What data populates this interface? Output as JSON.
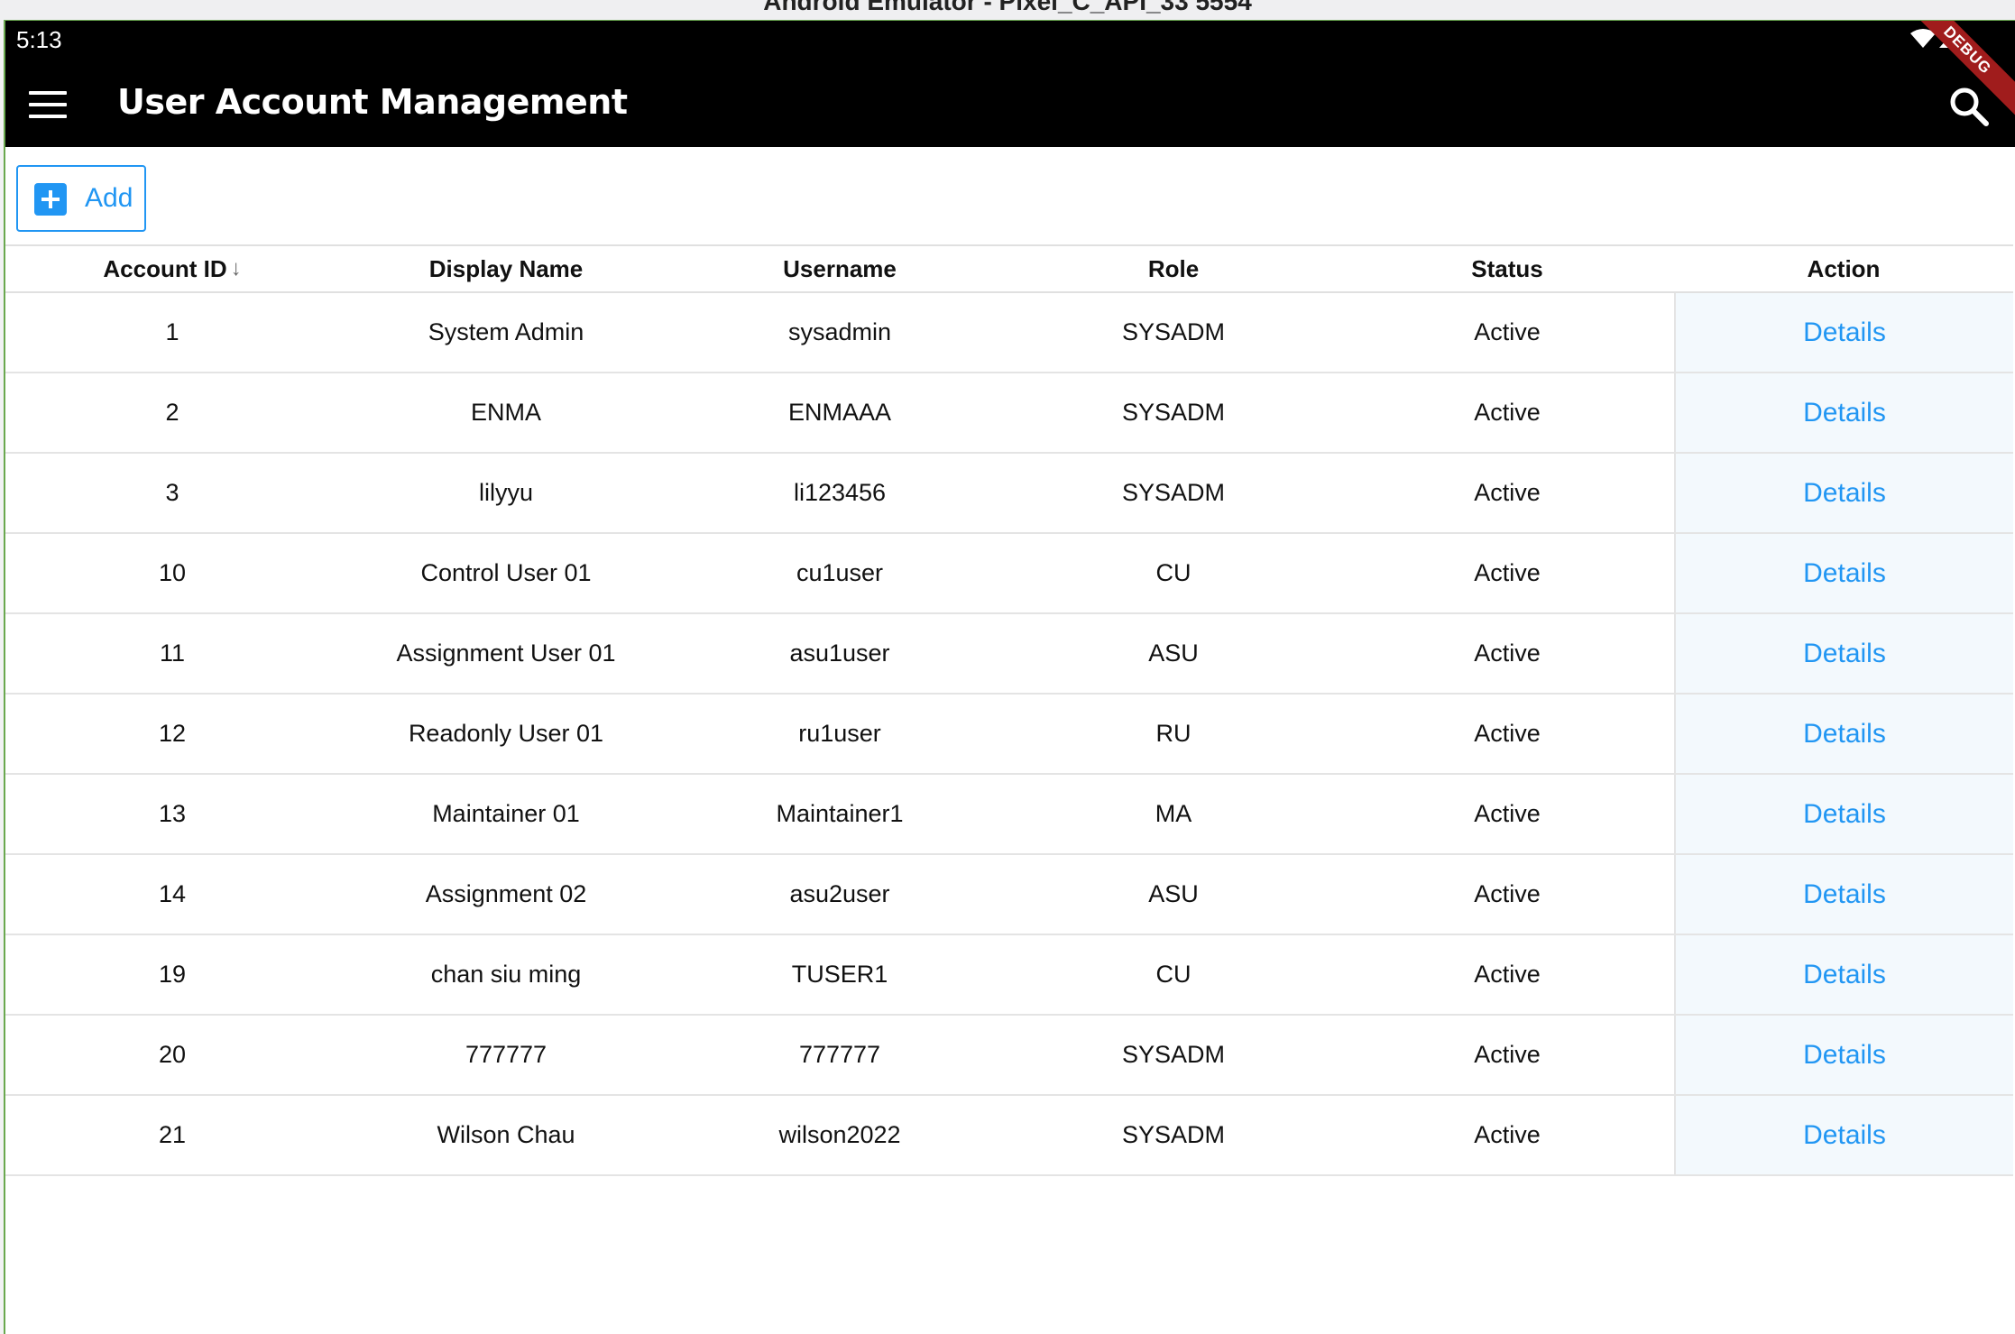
{
  "window_title": "Android Emulator - Pixel_C_API_33 5554",
  "status_bar": {
    "time": "5:13"
  },
  "app_bar": {
    "title": "User Account Management",
    "debug_banner": "DEBUG"
  },
  "toolbar": {
    "add_label": "Add"
  },
  "table": {
    "columns": [
      "Account ID",
      "Display Name",
      "Username",
      "Role",
      "Status",
      "Action"
    ],
    "sort_column": "Account ID",
    "rows": [
      {
        "id": "1",
        "display_name": "System Admin",
        "username": "sysadmin",
        "role": "SYSADM",
        "status": "Active",
        "action": "Details"
      },
      {
        "id": "2",
        "display_name": "ENMA",
        "username": "ENMAAA",
        "role": "SYSADM",
        "status": "Active",
        "action": "Details"
      },
      {
        "id": "3",
        "display_name": "lilyyu",
        "username": "li123456",
        "role": "SYSADM",
        "status": "Active",
        "action": "Details"
      },
      {
        "id": "10",
        "display_name": "Control User 01",
        "username": "cu1user",
        "role": "CU",
        "status": "Active",
        "action": "Details"
      },
      {
        "id": "11",
        "display_name": "Assignment User 01",
        "username": "asu1user",
        "role": "ASU",
        "status": "Active",
        "action": "Details"
      },
      {
        "id": "12",
        "display_name": "Readonly User 01",
        "username": "ru1user",
        "role": "RU",
        "status": "Active",
        "action": "Details"
      },
      {
        "id": "13",
        "display_name": "Maintainer 01",
        "username": "Maintainer1",
        "role": "MA",
        "status": "Active",
        "action": "Details"
      },
      {
        "id": "14",
        "display_name": "Assignment 02",
        "username": "asu2user",
        "role": "ASU",
        "status": "Active",
        "action": "Details"
      },
      {
        "id": "19",
        "display_name": "chan siu  ming",
        "username": "TUSER1",
        "role": "CU",
        "status": "Active",
        "action": "Details"
      },
      {
        "id": "20",
        "display_name": "777777",
        "username": "777777",
        "role": "SYSADM",
        "status": "Active",
        "action": "Details"
      },
      {
        "id": "21",
        "display_name": "Wilson Chau",
        "username": "wilson2022",
        "role": "SYSADM",
        "status": "Active",
        "action": "Details"
      }
    ]
  },
  "colors": {
    "accent": "#2196f3",
    "app_bar": "#000000",
    "action_cell": "#f3f9fd"
  },
  "icons": {
    "menu": "menu-icon",
    "search": "search-icon",
    "add": "add-icon",
    "sort": "arrow-down-icon",
    "wifi": "wifi-icon",
    "signal": "signal-icon"
  }
}
